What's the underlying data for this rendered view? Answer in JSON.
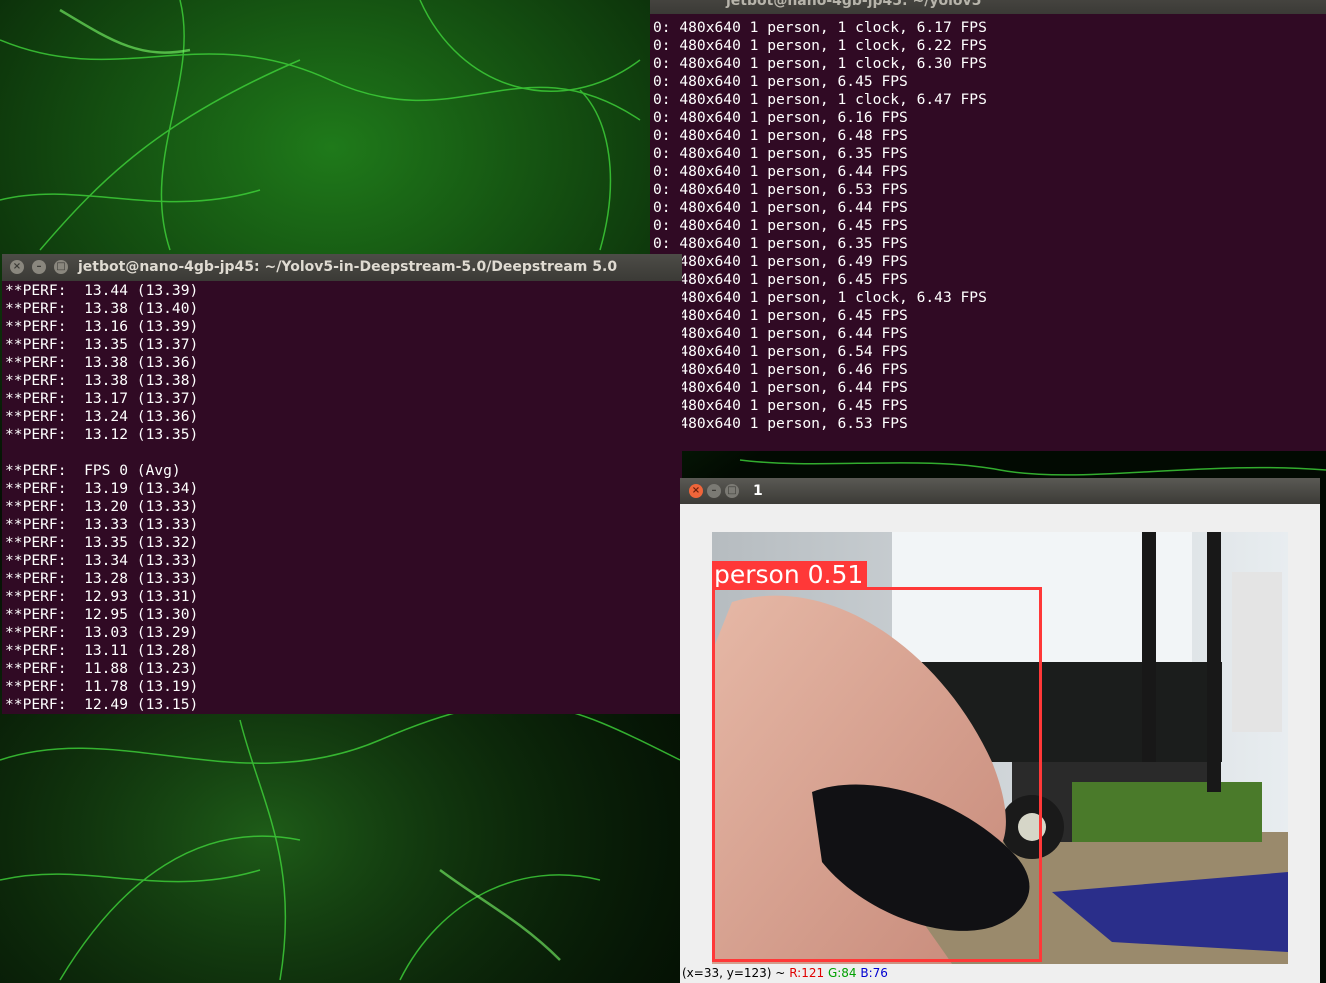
{
  "desktop": {
    "accent": "#39c13a",
    "background": "#020a02"
  },
  "right_terminal": {
    "title": "jetbot@nano-4gb-jp45: ~/yolov5",
    "lines": [
      "0: 480x640 1 person, 1 clock, 6.17 FPS",
      "0: 480x640 1 person, 1 clock, 6.22 FPS",
      "0: 480x640 1 person, 1 clock, 6.30 FPS",
      "0: 480x640 1 person, 6.45 FPS",
      "0: 480x640 1 person, 1 clock, 6.47 FPS",
      "0: 480x640 1 person, 6.16 FPS",
      "0: 480x640 1 person, 6.48 FPS",
      "0: 480x640 1 person, 6.35 FPS",
      "0: 480x640 1 person, 6.44 FPS",
      "0: 480x640 1 person, 6.53 FPS",
      "0: 480x640 1 person, 6.44 FPS",
      "0: 480x640 1 person, 6.45 FPS",
      "0: 480x640 1 person, 6.35 FPS",
      "0: 480x640 1 person, 6.49 FPS",
      "0: 480x640 1 person, 6.45 FPS",
      "0: 480x640 1 person, 1 clock, 6.43 FPS",
      "0: 480x640 1 person, 6.45 FPS",
      "0: 480x640 1 person, 6.44 FPS",
      "0: 480x640 1 person, 6.54 FPS",
      "0: 480x640 1 person, 6.46 FPS",
      "0: 480x640 1 person, 6.44 FPS",
      "0: 480x640 1 person, 6.45 FPS",
      "0: 480x640 1 person, 6.53 FPS"
    ]
  },
  "left_terminal": {
    "title": "jetbot@nano-4gb-jp45: ~/Yolov5-in-Deepstream-5.0/Deepstream 5.0",
    "lines": [
      "**PERF:  13.44 (13.39)",
      "**PERF:  13.38 (13.40)",
      "**PERF:  13.16 (13.39)",
      "**PERF:  13.35 (13.37)",
      "**PERF:  13.38 (13.36)",
      "**PERF:  13.38 (13.38)",
      "**PERF:  13.17 (13.37)",
      "**PERF:  13.24 (13.36)",
      "**PERF:  13.12 (13.35)",
      "",
      "**PERF:  FPS 0 (Avg)",
      "**PERF:  13.19 (13.34)",
      "**PERF:  13.20 (13.33)",
      "**PERF:  13.33 (13.33)",
      "**PERF:  13.35 (13.32)",
      "**PERF:  13.34 (13.33)",
      "**PERF:  13.28 (13.33)",
      "**PERF:  12.93 (13.31)",
      "**PERF:  12.95 (13.30)",
      "**PERF:  13.03 (13.29)",
      "**PERF:  13.11 (13.28)",
      "**PERF:  11.88 (13.23)",
      "**PERF:  11.78 (13.19)",
      "**PERF:  12.49 (13.15)"
    ]
  },
  "image_window": {
    "title": "1",
    "detection_label": "person 0.51",
    "detection_color": "#ff3838",
    "status": {
      "coords": "(x=33, y=123) ~",
      "r": "R:121",
      "g": "G:84",
      "b": "B:76"
    }
  },
  "icons": {
    "close": "close-icon",
    "minimize": "minimize-icon",
    "maximize": "maximize-icon"
  }
}
